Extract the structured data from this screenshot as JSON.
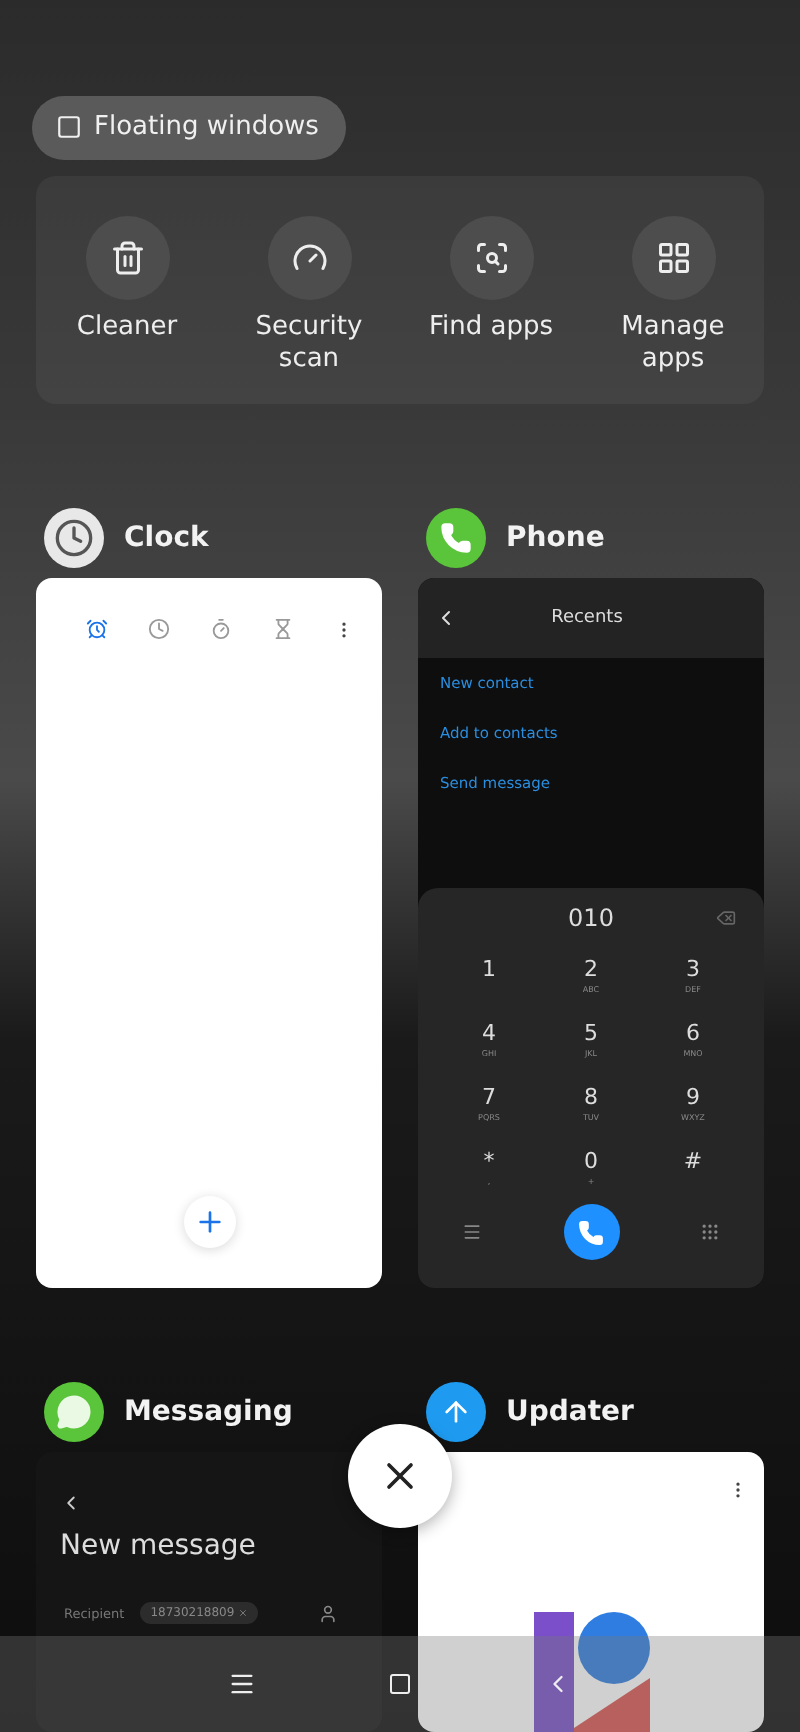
{
  "floating_button": {
    "label": "Floating windows"
  },
  "quick_actions": [
    {
      "label": "Cleaner",
      "kind": "trash"
    },
    {
      "label": "Security scan",
      "kind": "gauge"
    },
    {
      "label": "Find apps",
      "kind": "find"
    },
    {
      "label": "Manage apps",
      "kind": "grid"
    }
  ],
  "clock_app": {
    "name": "Clock",
    "tabs": [
      {
        "kind": "alarm",
        "selected": true
      },
      {
        "kind": "clock",
        "selected": false
      },
      {
        "kind": "stopwatch",
        "selected": false
      },
      {
        "kind": "timer",
        "selected": false
      }
    ]
  },
  "phone_app": {
    "name": "Phone",
    "title": "Recents",
    "links": [
      "New contact",
      "Add to contacts",
      "Send message"
    ],
    "number": "010",
    "keys": [
      {
        "digit": "1"
      },
      {
        "digit": "2",
        "letters": "ABC"
      },
      {
        "digit": "3",
        "letters": "DEF"
      },
      {
        "digit": "4",
        "letters": "GHI"
      },
      {
        "digit": "5",
        "letters": "JKL"
      },
      {
        "digit": "6",
        "letters": "MNO"
      },
      {
        "digit": "7",
        "letters": "PQRS"
      },
      {
        "digit": "8",
        "letters": "TUV"
      },
      {
        "digit": "9",
        "letters": "WXYZ"
      },
      {
        "digit": "*",
        "letters": ","
      },
      {
        "digit": "0",
        "letters": "+"
      },
      {
        "digit": "#"
      }
    ]
  },
  "messaging_app": {
    "name": "Messaging",
    "title": "New message",
    "recipient_label": "Recipient",
    "recipient": "18730218809"
  },
  "updater_app": {
    "name": "Updater"
  }
}
